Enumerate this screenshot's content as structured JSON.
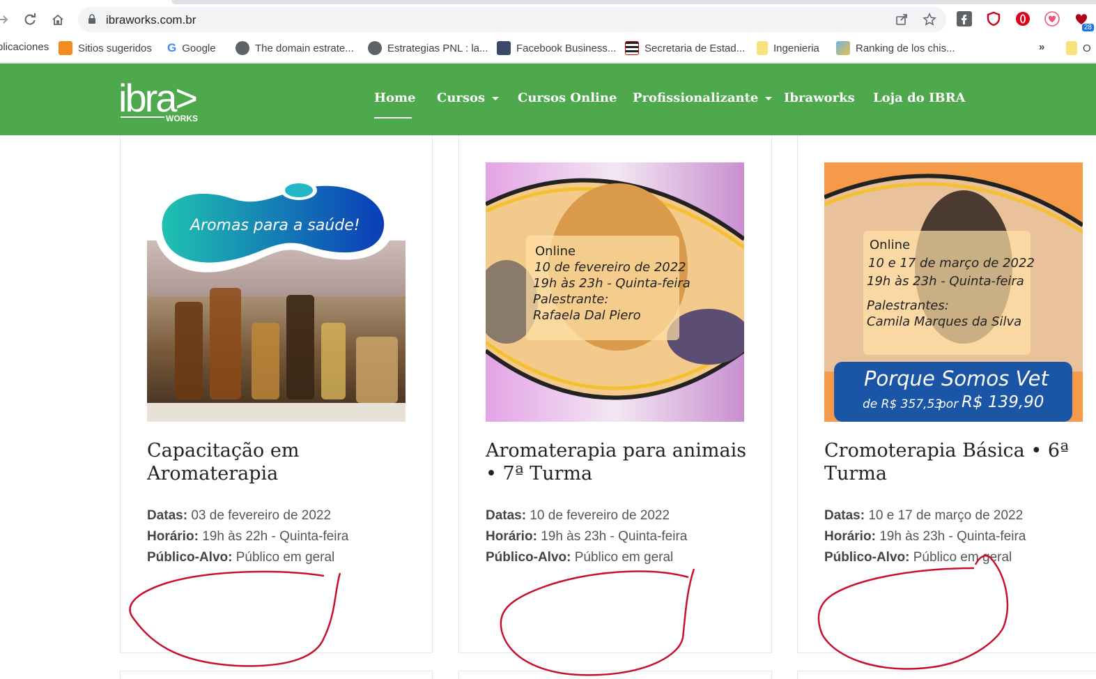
{
  "browser": {
    "url": "ibraworks.com.br",
    "extension_badge": "28",
    "bookmarks": [
      {
        "label": "plicaciones",
        "icon": "apps-icon"
      },
      {
        "label": "Sitios sugeridos",
        "icon": "bulb-icon"
      },
      {
        "label": "Google",
        "icon": "google-icon"
      },
      {
        "label": "The domain estrate...",
        "icon": "globe-icon"
      },
      {
        "label": "Estrategias PNL : la...",
        "icon": "globe-icon"
      },
      {
        "label": "Facebook Business...",
        "icon": "facebook-page-icon"
      },
      {
        "label": "Secretaria de Estad...",
        "icon": "flag-icon"
      },
      {
        "label": "Ingenieria",
        "icon": "folder-icon"
      },
      {
        "label": "Ranking de los chis...",
        "icon": "image-icon"
      }
    ],
    "overflow": "»",
    "last_bookmark": "O"
  },
  "site": {
    "logo_text": "ibra>",
    "logo_sub": "WORKS",
    "nav": [
      {
        "label": "Home",
        "active": true
      },
      {
        "label": "Cursos",
        "dropdown": true
      },
      {
        "label": "Cursos Online"
      },
      {
        "label": "Profissionalizante",
        "dropdown": true
      },
      {
        "label": "Ibraworks"
      },
      {
        "label": "Loja do IBRA"
      }
    ],
    "brand_color": "#4ea84c"
  },
  "courses": [
    {
      "title_line1": "Capacitação em",
      "title_line2": "Aromaterapia",
      "image_caption": "Aromas para a saúde!",
      "dates_label": "Datas:",
      "dates": "03 de fevereiro de 2022",
      "time_label": "Horário:",
      "time": "19h às 22h - Quinta-feira",
      "audience_label": "Público-Alvo:",
      "audience": "Público em geral"
    },
    {
      "title_line1": "Aromaterapia para animais",
      "title_line2": "• 7ª Turma",
      "image_lines": [
        "Online",
        "10 de fevereiro de 2022",
        "19h às 23h - Quinta-feira",
        "Palestrante:",
        "Rafaela Dal Piero"
      ],
      "dates_label": "Datas:",
      "dates": "10 de fevereiro de 2022",
      "time_label": "Horário:",
      "time": "19h às 23h - Quinta-feira",
      "audience_label": "Público-Alvo:",
      "audience": "Público em geral"
    },
    {
      "title_line1": "Cromoterapia Básica • 6ª",
      "title_line2": "Turma",
      "image_lines": [
        "Online",
        "10 e 17 de março de 2022",
        "19h às 23h - Quinta-feira",
        "Palestrantes:",
        "Camila Marques da Silva"
      ],
      "image_banner": "Porque Somos Vet",
      "image_price_from": "de R$ 357,53",
      "image_price_to_prefix": "por",
      "image_price_to": "R$ 139,90",
      "dates_label": "Datas:",
      "dates": "10 e 17 de março de 2022",
      "time_label": "Horário:",
      "time": "19h às 23h - Quinta-feira",
      "audience_label": "Público-Alvo:",
      "audience": "Público em geral"
    }
  ]
}
